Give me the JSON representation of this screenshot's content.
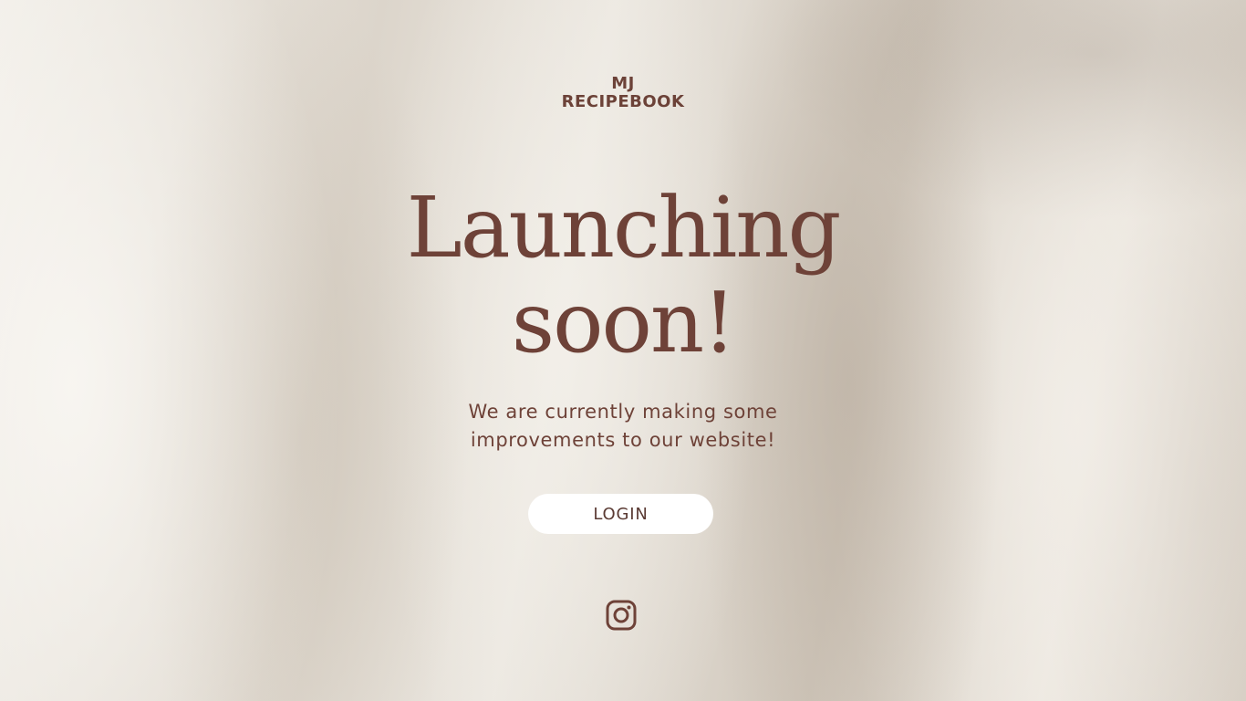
{
  "brand": {
    "line1": "MJ",
    "line2": "RECIPEBOOK"
  },
  "hero": {
    "title_line1": "Launching",
    "title_line2": "soon!",
    "subtitle_line1": "We are currently making some",
    "subtitle_line2": "improvements to our website!"
  },
  "login_button": {
    "label": "LOGIN"
  },
  "social": {
    "icon": "instagram-icon"
  },
  "colors": {
    "text": "#6e4238",
    "button_bg": "#ffffff"
  }
}
